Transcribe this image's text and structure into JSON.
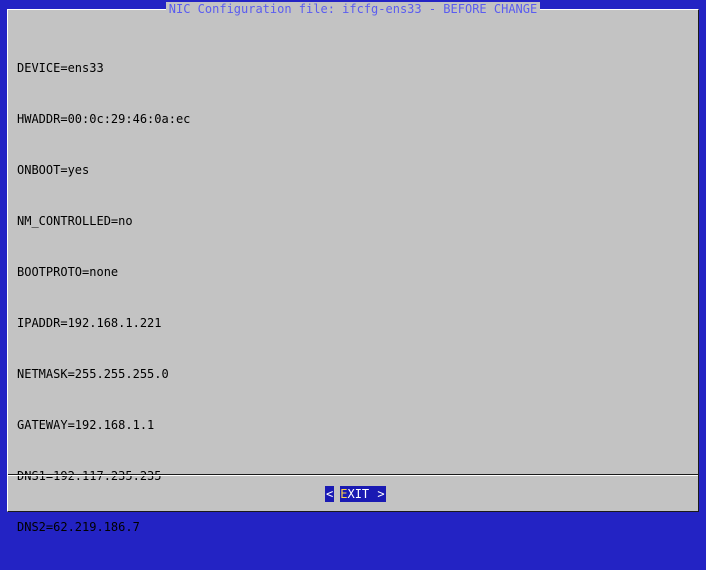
{
  "dialog": {
    "title": "NIC Configuration file: ifcfg-ens33 - BEFORE CHANGE",
    "lines": [
      "DEVICE=ens33",
      "HWADDR=00:0c:29:46:0a:ec",
      "ONBOOT=yes",
      "NM_CONTROLLED=no",
      "BOOTPROTO=none",
      "IPADDR=192.168.1.221",
      "NETMASK=255.255.255.0",
      "GATEWAY=192.168.1.1",
      "DNS1=192.117.235.235",
      "DNS2=62.219.186.7"
    ]
  },
  "exit_button": {
    "left_bracket": "<",
    "hotkey": "E",
    "rest": "XIT",
    "right_bracket": ">"
  },
  "colors": {
    "background": "#2323c4",
    "dialog": "#c3c3c3",
    "title_text": "#5a5cf0",
    "button_bg": "#1a1ab3",
    "hotkey": "#ffd24a"
  }
}
